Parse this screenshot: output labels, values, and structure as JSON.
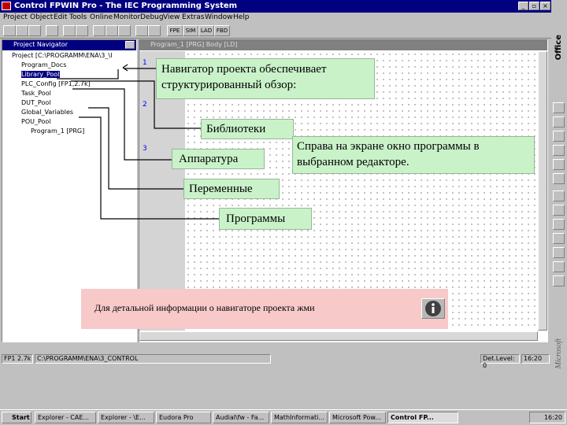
{
  "window": {
    "title": "Control FPWIN Pro - The IEC Programming System"
  },
  "menu": [
    "Project",
    "Object",
    "Edit",
    "Tools",
    "Online",
    "Monitor",
    "Debug",
    "View",
    "Extras",
    "Window",
    "Help"
  ],
  "toolbar": {
    "fpe_label": "FPE",
    "sim_label": "SIM",
    "lad_label": "LAD",
    "fbd_label": "FBD"
  },
  "navigator": {
    "title": "Project Navigator",
    "items": [
      "Project [C:\\PROGRAMM\\ENA\\3_\\I",
      "Program_Docs",
      "Library_Pool",
      "PLC_Config [FP1,2.7k]",
      "Task_Pool",
      "DUT_Pool",
      "Global_Variables",
      "POU_Pool",
      "Program_1 [PRG]"
    ]
  },
  "program_window": {
    "title": "Program_1 [PRG] Body [LD]",
    "rows": [
      "1",
      "2",
      "3"
    ]
  },
  "callouts": {
    "navigator_desc": "Навигатор проекта обеспечивает структурированный обзор:",
    "libraries": "Библиотеки",
    "hardware": "Аппаратура",
    "variables": "Переменные",
    "programs": "Программы",
    "right_side": "Справа на экране окно программы в выбранном редакторе."
  },
  "info": {
    "text": "Для детальной информации о навигаторе проекта  жми",
    "icon": "info-icon"
  },
  "status": {
    "left": "FP1 2.7k",
    "path": "C:\\PROGRAMM\\ENA\\3_CONTROL",
    "right": "Det.Level: 0",
    "time": "16:20"
  },
  "taskbar": {
    "start": "Start",
    "tasks": [
      "Explorer - CAE...",
      "Explorer - \\E...",
      "Eudora Pro",
      "Audial\\fw - Fa...",
      "MathInformati...",
      "Microsoft Pow...",
      "Control FP..."
    ],
    "clock": "16:20"
  },
  "office_bar": {
    "top_label": "Office",
    "bottom_label": "Microsoft"
  }
}
